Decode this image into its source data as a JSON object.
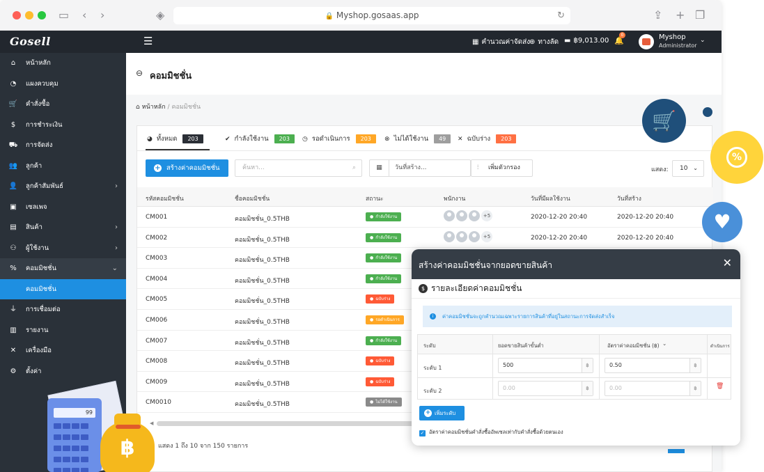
{
  "browser": {
    "url": "Myshop.gosaas.app"
  },
  "topbar": {
    "logo": "Gosell",
    "shipping_calc": "คำนวณค่าจัดส่ง",
    "shortcut": "ทางลัด",
    "balance": "฿9,013.00",
    "bell_count": "0",
    "user_name": "Myshop",
    "user_role": "Administrator"
  },
  "sidebar": {
    "items": [
      {
        "label": "หน้าหลัก",
        "icon": "home-icon"
      },
      {
        "label": "แผงควบคุม",
        "icon": "dashboard-icon"
      },
      {
        "label": "คำสั่งซื้อ",
        "icon": "cart-icon"
      },
      {
        "label": "การชำระเงิน",
        "icon": "dollar-icon"
      },
      {
        "label": "การจัดส่ง",
        "icon": "truck-icon"
      },
      {
        "label": "ลูกค้า",
        "icon": "users-icon"
      },
      {
        "label": "ลูกค้าสัมพันธ์",
        "icon": "crm-icon"
      },
      {
        "label": "เซลเพจ",
        "icon": "browser-icon"
      },
      {
        "label": "สินค้า",
        "icon": "boxes-icon"
      },
      {
        "label": "ผู้ใช้งาน",
        "icon": "staff-icon"
      },
      {
        "label": "คอมมิชชั่น",
        "icon": "percent-icon"
      },
      {
        "label": "คอมมิชชั่น",
        "icon": ""
      },
      {
        "label": "การเชื่อมต่อ",
        "icon": "plug-icon"
      },
      {
        "label": "รายงาน",
        "icon": "chart-icon"
      },
      {
        "label": "เครื่องมือ",
        "icon": "tools-icon"
      },
      {
        "label": "ตั้งค่า",
        "icon": "gear-icon"
      }
    ]
  },
  "page": {
    "title": "คอมมิชชั่น",
    "breadcrumb_home": "หน้าหลัก",
    "breadcrumb_sep": "/",
    "breadcrumb_current": "คอมมิชชั่น"
  },
  "tabs": [
    {
      "label": "ทั้งหมด",
      "count": "203",
      "color": "#2b2f36"
    },
    {
      "label": "กำลังใช้งาน",
      "count": "203",
      "color": "#4caf50"
    },
    {
      "label": "รอดำเนินการ",
      "count": "203",
      "color": "#ffa726"
    },
    {
      "label": "ไม่ได้ใช้งาน",
      "count": "49",
      "color": "#9e9e9e"
    },
    {
      "label": "ฉบับร่าง",
      "count": "203",
      "color": "#ff7043"
    }
  ],
  "toolbar": {
    "create_label": "สร้างค่าคอมมิชชั่น",
    "search_placeholder": "ค้นหา...",
    "date_label": "วันที่สร้าง...",
    "filter_label": "เพิ่มตัวกรอง",
    "show_label": "แสดง:",
    "show_value": "10"
  },
  "table": {
    "headers": [
      "รหัสคอมมิชชั่น",
      "ชื่อคอมมิชชั่น",
      "สถานะ",
      "พนักงาน",
      "วันที่มีผลใช้งาน",
      "วันที่สร้าง"
    ],
    "rows": [
      {
        "code": "CM001",
        "name": "คอมมิชชั่น_0.5THB",
        "status": "กำลังใช้งาน",
        "status_color": "#4caf50",
        "staff": "+5",
        "effective": "2020-12-20 20:40",
        "created": "2020-12-20 20:40"
      },
      {
        "code": "CM002",
        "name": "คอมมิชชั่น_0.5THB",
        "status": "กำลังใช้งาน",
        "status_color": "#4caf50",
        "staff": "+5",
        "effective": "2020-12-20 20:40",
        "created": "2020-12-20 20:40"
      },
      {
        "code": "CM003",
        "name": "คอมมิชชั่น_0.5THB",
        "status": "กำลังใช้งาน",
        "status_color": "#4caf50",
        "staff": "",
        "effective": "",
        "created": ""
      },
      {
        "code": "CM004",
        "name": "คอมมิชชั่น_0.5THB",
        "status": "กำลังใช้งาน",
        "status_color": "#4caf50",
        "staff": "",
        "effective": "",
        "created": ""
      },
      {
        "code": "CM005",
        "name": "คอมมิชชั่น_0.5THB",
        "status": "ฉบับร่าง",
        "status_color": "#ff5a36",
        "staff": "",
        "effective": "",
        "created": ""
      },
      {
        "code": "CM006",
        "name": "คอมมิชชั่น_0.5THB",
        "status": "รอดำเนินการ",
        "status_color": "#ffa726",
        "staff": "",
        "effective": "",
        "created": ""
      },
      {
        "code": "CM007",
        "name": "คอมมิชชั่น_0.5THB",
        "status": "กำลังใช้งาน",
        "status_color": "#4caf50",
        "staff": "",
        "effective": "",
        "created": ""
      },
      {
        "code": "CM008",
        "name": "คอมมิชชั่น_0.5THB",
        "status": "ฉบับร่าง",
        "status_color": "#ff5a36",
        "staff": "",
        "effective": "",
        "created": ""
      },
      {
        "code": "CM009",
        "name": "คอมมิชชั่น_0.5THB",
        "status": "ฉบับร่าง",
        "status_color": "#ff5a36",
        "staff": "",
        "effective": "",
        "created": ""
      },
      {
        "code": "CM0010",
        "name": "คอมมิชชั่น_0.5THB",
        "status": "ไม่ได้ใช้งาน",
        "status_color": "#8a8a8a",
        "staff": "",
        "effective": "",
        "created": ""
      }
    ],
    "footer": "แสดง 1 ถึง 10 จาก 150 รายการ"
  },
  "modal": {
    "title": "สร้างค่าคอมมิชชั่นจากยอดขายสินค้า",
    "section_title": "รายละเอียดค่าคอมมิชชั่น",
    "info": "ค่าคอมมิชชั่นจะถูกคำนวณเฉพาะรายการสินค้าที่อยู่ในสถานะการจัดส่งสำเร็จ",
    "headers": [
      "ระดับ",
      "ยอดขายสินค้าขั้นต่ำ",
      "อัตราค่าคอมมิชชั่น (฿)",
      "ดำเนินการ"
    ],
    "rows": [
      {
        "level": "ระดับ 1",
        "min_sales": "500",
        "rate": "0.50"
      },
      {
        "level": "ระดับ 2",
        "min_sales_placeholder": "0.00",
        "rate_placeholder": "0.00"
      }
    ],
    "unit": "฿",
    "add_level_label": "เพิ่มระดับ",
    "checkbox_label": "อัตราค่าคอมมิชชั่นคำสั่งซื้ออัพเซลเท่ากับคำสั่งซื้อด้วยตนเอง"
  },
  "illustration": {
    "calculator_display": "99",
    "bag_symbol": "฿"
  }
}
